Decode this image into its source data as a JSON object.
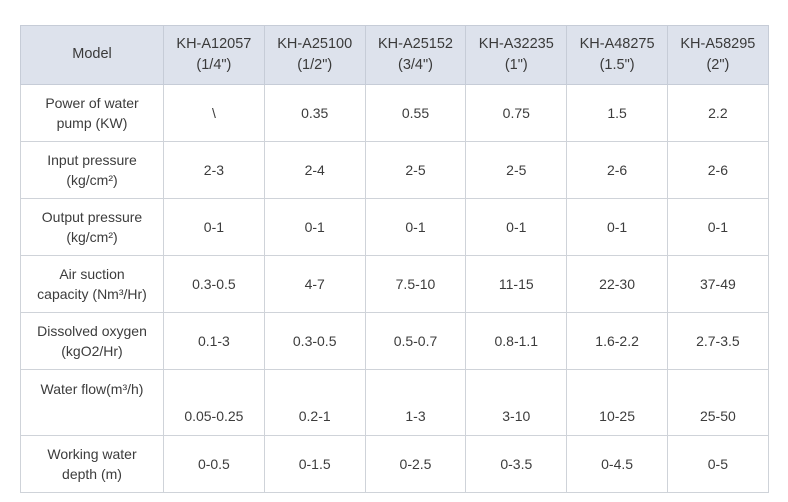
{
  "table": {
    "header": {
      "label_column": "Model",
      "models": [
        {
          "code": "KH-A12057",
          "size": "(1/4\")"
        },
        {
          "code": "KH-A25100",
          "size": "(1/2\")"
        },
        {
          "code": "KH-A25152",
          "size": "(3/4\")"
        },
        {
          "code": "KH-A32235",
          "size": "(1\")"
        },
        {
          "code": "KH-A48275",
          "size": "(1.5\")"
        },
        {
          "code": "KH-A58295",
          "size": "(2\")"
        }
      ]
    },
    "rows": [
      {
        "label_line1": "Power of water",
        "label_line2": "pump (KW)",
        "values": [
          "\\",
          "0.35",
          "0.55",
          "0.75",
          "1.5",
          "2.2"
        ]
      },
      {
        "label_line1": "Input pressure",
        "label_line2": "(kg/cm²)",
        "values": [
          "2-3",
          "2-4",
          "2-5",
          "2-5",
          "2-6",
          "2-6"
        ]
      },
      {
        "label_line1": "Output pressure",
        "label_line2": "(kg/cm²)",
        "values": [
          "0-1",
          "0-1",
          "0-1",
          "0-1",
          "0-1",
          "0-1"
        ]
      },
      {
        "label_line1": "Air suction",
        "label_line2": "capacity  (Nm³/Hr)",
        "values": [
          "0.3-0.5",
          "4-7",
          "7.5-10",
          "11-15",
          "22-30",
          "37-49"
        ]
      },
      {
        "label_line1": "Dissolved oxygen",
        "label_line2": "(kgO2/Hr)",
        "values": [
          "0.1-3",
          "0.3-0.5",
          "0.5-0.7",
          "0.8-1.1",
          "1.6-2.2",
          "2.7-3.5"
        ]
      },
      {
        "label_line1": "Water flow(m³/h)",
        "label_line2": "",
        "values": [
          "0.05-0.25",
          "0.2-1",
          "1-3",
          "3-10",
          "10-25",
          "25-50"
        ]
      },
      {
        "label_line1": "Working water",
        "label_line2": "depth (m)",
        "values": [
          "0-0.5",
          "0-1.5",
          "0-2.5",
          "0-3.5",
          "0-4.5",
          "0-5"
        ]
      }
    ]
  },
  "colors": {
    "header_background": "#dde2ec",
    "border": "#cfd3d9",
    "text": "#3c3c3c",
    "page_background": "#ffffff"
  }
}
